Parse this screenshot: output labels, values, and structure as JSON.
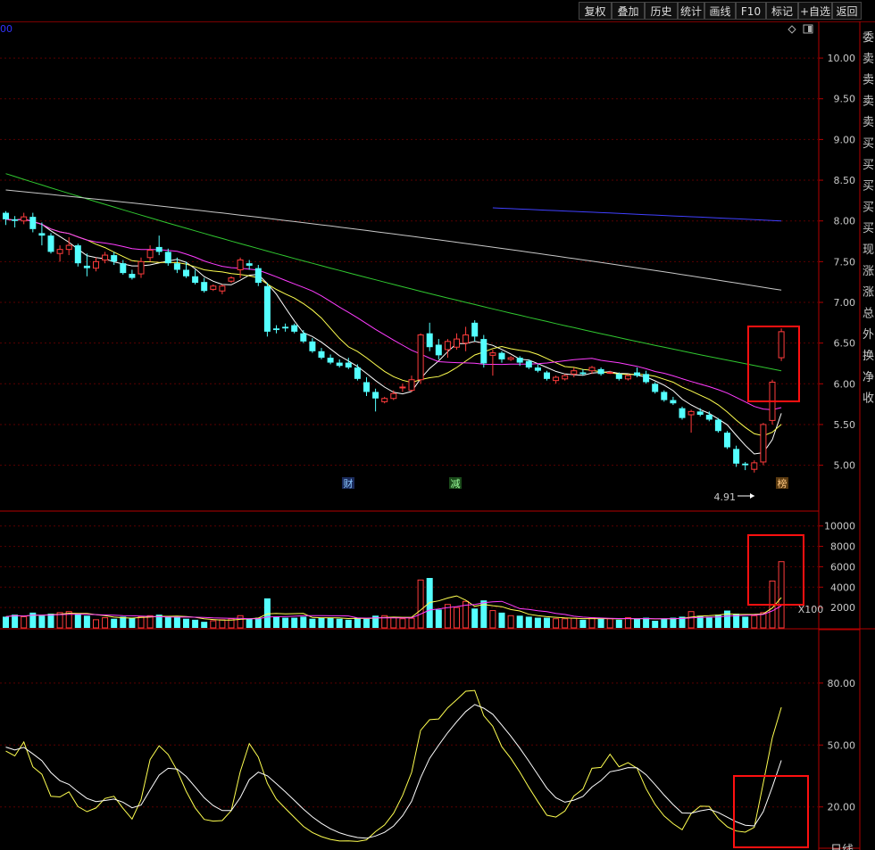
{
  "toolbar": {
    "buttons": [
      "复权",
      "叠加",
      "历史",
      "统计",
      "画线",
      "F10",
      "标记",
      "+自选",
      "返回"
    ]
  },
  "top_left_value": "00",
  "volume_unit": "X100",
  "low_marker": "4.91",
  "event_markers": [
    "财",
    "减",
    "榜"
  ],
  "right_panel_chars": [
    "委",
    "卖",
    "卖",
    "卖",
    "卖",
    "买",
    "买",
    "买",
    "买",
    "买",
    "现",
    "涨",
    "涨",
    "总",
    "外",
    "换",
    "净",
    "收"
  ],
  "bottom_right_label": "日线",
  "colors": {
    "up": "#ff3c3c",
    "down": "#54ffff",
    "ma5": "#ffffff",
    "ma10": "#ffff50",
    "ma20": "#ff3cff",
    "ma60": "#30c830",
    "ma120": "#c8c8c8",
    "ma250": "#4040ff",
    "frame": "#b40000",
    "highlight": "#ff1010"
  },
  "chart_data": [
    {
      "type": "candlestick",
      "title": "",
      "y_ticks": [
        "10.00",
        "9.50",
        "9.00",
        "8.50",
        "8.00",
        "7.50",
        "7.00",
        "6.50",
        "6.00",
        "5.50",
        "5.00"
      ],
      "ylim": [
        4.7,
        10.45
      ],
      "ohlc": [
        [
          8.1,
          8.12,
          7.95,
          8.02
        ],
        [
          8.02,
          8.06,
          7.92,
          8.0
        ],
        [
          8.0,
          8.1,
          7.96,
          8.05
        ],
        [
          8.05,
          8.1,
          7.86,
          7.9
        ],
        [
          7.85,
          7.98,
          7.7,
          7.82
        ],
        [
          7.82,
          7.85,
          7.6,
          7.62
        ],
        [
          7.6,
          7.7,
          7.5,
          7.65
        ],
        [
          7.65,
          7.8,
          7.58,
          7.7
        ],
        [
          7.7,
          7.72,
          7.44,
          7.48
        ],
        [
          7.45,
          7.6,
          7.32,
          7.42
        ],
        [
          7.42,
          7.55,
          7.38,
          7.5
        ],
        [
          7.52,
          7.62,
          7.48,
          7.58
        ],
        [
          7.58,
          7.62,
          7.46,
          7.5
        ],
        [
          7.48,
          7.52,
          7.34,
          7.36
        ],
        [
          7.35,
          7.4,
          7.28,
          7.3
        ],
        [
          7.35,
          7.55,
          7.3,
          7.5
        ],
        [
          7.55,
          7.7,
          7.5,
          7.64
        ],
        [
          7.68,
          7.82,
          7.58,
          7.62
        ],
        [
          7.62,
          7.66,
          7.45,
          7.48
        ],
        [
          7.48,
          7.55,
          7.36,
          7.4
        ],
        [
          7.4,
          7.5,
          7.3,
          7.32
        ],
        [
          7.32,
          7.4,
          7.22,
          7.24
        ],
        [
          7.25,
          7.3,
          7.12,
          7.14
        ],
        [
          7.16,
          7.22,
          7.14,
          7.2
        ],
        [
          7.14,
          7.22,
          7.1,
          7.2
        ],
        [
          7.26,
          7.32,
          7.24,
          7.3
        ],
        [
          7.4,
          7.55,
          7.3,
          7.52
        ],
        [
          7.48,
          7.52,
          7.4,
          7.45
        ],
        [
          7.42,
          7.46,
          7.2,
          7.24
        ],
        [
          7.2,
          7.24,
          6.58,
          6.64
        ],
        [
          6.68,
          6.72,
          6.62,
          6.66
        ],
        [
          6.7,
          6.74,
          6.64,
          6.68
        ],
        [
          6.72,
          6.74,
          6.62,
          6.64
        ],
        [
          6.62,
          6.66,
          6.5,
          6.52
        ],
        [
          6.52,
          6.56,
          6.38,
          6.4
        ],
        [
          6.4,
          6.44,
          6.3,
          6.32
        ],
        [
          6.32,
          6.36,
          6.24,
          6.26
        ],
        [
          6.26,
          6.3,
          6.2,
          6.22
        ],
        [
          6.26,
          6.32,
          6.18,
          6.2
        ],
        [
          6.2,
          6.24,
          6.04,
          6.06
        ],
        [
          6.02,
          6.08,
          5.85,
          5.9
        ],
        [
          5.9,
          5.94,
          5.66,
          5.82
        ],
        [
          5.78,
          5.84,
          5.76,
          5.82
        ],
        [
          5.82,
          5.92,
          5.8,
          5.88
        ],
        [
          5.95,
          6.0,
          5.9,
          5.96
        ],
        [
          5.92,
          6.1,
          5.9,
          6.05
        ],
        [
          6.05,
          6.62,
          6.0,
          6.6
        ],
        [
          6.62,
          6.75,
          6.4,
          6.45
        ],
        [
          6.48,
          6.55,
          6.3,
          6.35
        ],
        [
          6.42,
          6.55,
          6.32,
          6.52
        ],
        [
          6.45,
          6.62,
          6.42,
          6.55
        ],
        [
          6.5,
          6.7,
          6.4,
          6.6
        ],
        [
          6.75,
          6.78,
          6.52,
          6.58
        ],
        [
          6.55,
          6.6,
          6.2,
          6.25
        ],
        [
          6.35,
          6.42,
          6.1,
          6.38
        ],
        [
          6.38,
          6.4,
          6.26,
          6.3
        ],
        [
          6.3,
          6.34,
          6.28,
          6.32
        ],
        [
          6.32,
          6.34,
          6.22,
          6.26
        ],
        [
          6.28,
          6.3,
          6.18,
          6.2
        ],
        [
          6.2,
          6.24,
          6.14,
          6.16
        ],
        [
          6.14,
          6.16,
          6.04,
          6.06
        ],
        [
          6.04,
          6.1,
          6.0,
          6.08
        ],
        [
          6.06,
          6.12,
          6.04,
          6.1
        ],
        [
          6.12,
          6.2,
          6.08,
          6.16
        ],
        [
          6.14,
          6.18,
          6.1,
          6.12
        ],
        [
          6.16,
          6.22,
          6.12,
          6.2
        ],
        [
          6.18,
          6.2,
          6.1,
          6.12
        ],
        [
          6.14,
          6.16,
          6.12,
          6.14
        ],
        [
          6.12,
          6.14,
          6.04,
          6.06
        ],
        [
          6.06,
          6.12,
          6.04,
          6.1
        ],
        [
          6.14,
          6.2,
          6.08,
          6.1
        ],
        [
          6.12,
          6.16,
          6.0,
          6.02
        ],
        [
          6.0,
          6.02,
          5.88,
          5.9
        ],
        [
          5.9,
          5.92,
          5.78,
          5.8
        ],
        [
          5.8,
          5.84,
          5.74,
          5.76
        ],
        [
          5.7,
          5.72,
          5.56,
          5.58
        ],
        [
          5.62,
          5.68,
          5.4,
          5.66
        ],
        [
          5.66,
          5.7,
          5.6,
          5.62
        ],
        [
          5.62,
          5.66,
          5.54,
          5.56
        ],
        [
          5.56,
          5.58,
          5.4,
          5.42
        ],
        [
          5.4,
          5.42,
          5.2,
          5.22
        ],
        [
          5.2,
          5.24,
          4.98,
          5.02
        ],
        [
          5.02,
          5.04,
          4.94,
          5.0
        ],
        [
          4.95,
          5.06,
          4.91,
          5.03
        ],
        [
          5.04,
          5.52,
          5.0,
          5.5
        ],
        [
          5.55,
          6.05,
          5.5,
          6.02
        ],
        [
          6.32,
          6.68,
          6.28,
          6.64
        ]
      ]
    },
    {
      "type": "bar",
      "title": "",
      "y_ticks": [
        "10000",
        "8000",
        "6000",
        "4000",
        "2000"
      ],
      "ylim": [
        0,
        11200
      ],
      "values": [
        1100,
        1300,
        1100,
        1500,
        1200,
        1400,
        1500,
        1600,
        1400,
        1200,
        800,
        1000,
        900,
        1100,
        1000,
        1100,
        1200,
        1300,
        1100,
        1100,
        900,
        800,
        600,
        700,
        800,
        900,
        1200,
        900,
        1000,
        2900,
        1100,
        1000,
        1000,
        1100,
        900,
        1000,
        1000,
        900,
        800,
        1000,
        900,
        1200,
        1200,
        1000,
        900,
        950,
        4700,
        4900,
        1800,
        2300,
        2000,
        2600,
        1900,
        2700,
        1700,
        1500,
        1200,
        1200,
        1100,
        1000,
        1000,
        900,
        900,
        950,
        800,
        1000,
        900,
        900,
        800,
        1000,
        900,
        1000,
        700,
        900,
        1000,
        1100,
        1600,
        1200,
        1100,
        1300,
        1700,
        1400,
        1100,
        1200,
        1500,
        4600,
        6500
      ]
    },
    {
      "type": "line",
      "title": "",
      "y_ticks": [
        "80.00",
        "50.00",
        "20.00"
      ],
      "ylim": [
        0,
        105
      ]
    }
  ]
}
